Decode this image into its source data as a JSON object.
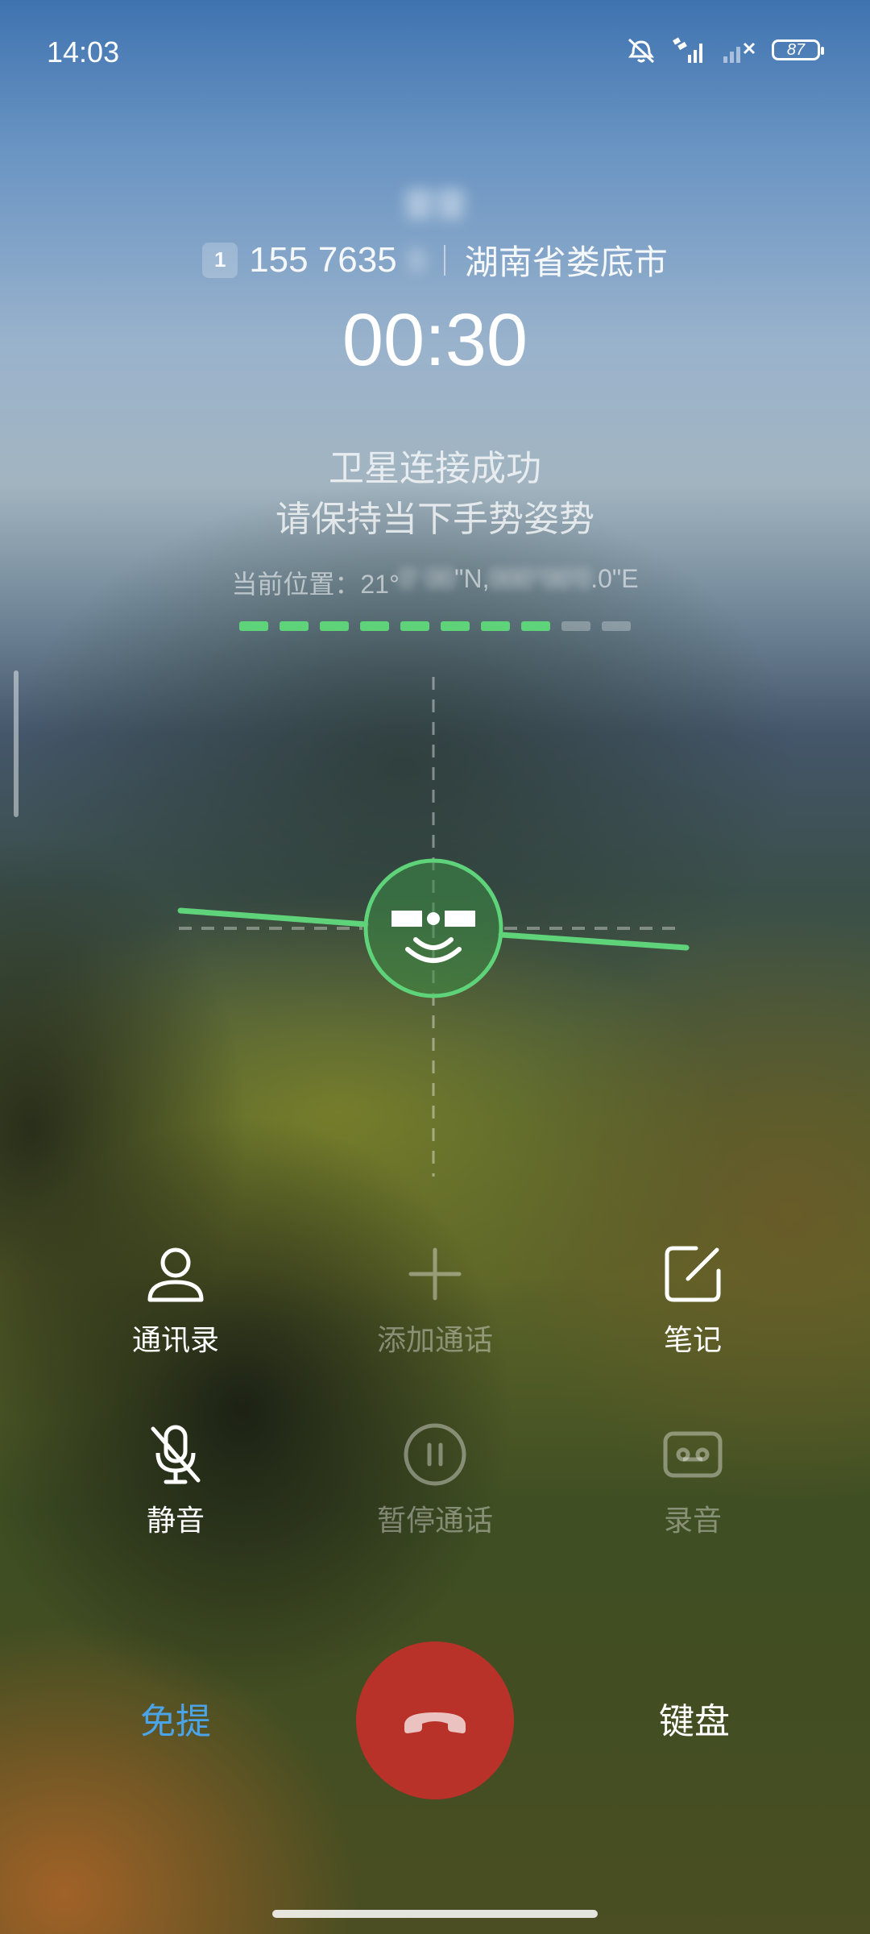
{
  "status_bar": {
    "time": "14:03",
    "battery": "87"
  },
  "caller": {
    "name": "雷雷",
    "sim_slot": "1",
    "number_visible": "155 7635",
    "number_hidden": "9",
    "location": "湖南省娄底市",
    "duration": "00:30"
  },
  "satellite": {
    "status": "卫星连接成功",
    "hint": "请保持当下手势姿势",
    "position_label": "当前位置：21°",
    "position_lat_hidden": "0' 00",
    "position_mid": "\"N, ",
    "position_lon_hidden": "000°00'0",
    "position_end": ".0\"E",
    "signal_level": 8,
    "signal_total": 10,
    "accent_color": "#5fd37a"
  },
  "actions": {
    "contacts": "通讯录",
    "add_call": "添加通话",
    "notes": "笔记",
    "mute": "静音",
    "hold": "暂停通话",
    "record": "录音"
  },
  "bottom": {
    "speaker": "免提",
    "keypad": "键盘",
    "hangup_color": "#b8322a",
    "speaker_color": "#4ba3e8"
  }
}
